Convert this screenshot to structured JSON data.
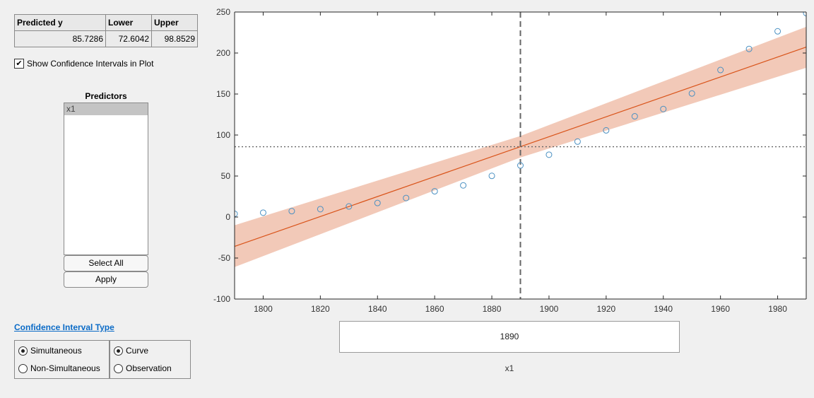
{
  "prediction_table": {
    "headers": [
      "Predicted y",
      "Lower",
      "Upper"
    ],
    "values": [
      "85.7286",
      "72.6042",
      "98.8529"
    ]
  },
  "show_ci_checkbox": {
    "label": "Show Confidence Intervals in Plot",
    "checked": true
  },
  "predictors": {
    "title": "Predictors",
    "items": [
      "x1"
    ],
    "select_all_label": "Select All",
    "apply_label": "Apply"
  },
  "ci_type": {
    "title": "Confidence Interval Type",
    "group1": [
      {
        "label": "Simultaneous",
        "selected": true
      },
      {
        "label": "Non-Simultaneous",
        "selected": false
      }
    ],
    "group2": [
      {
        "label": "Curve",
        "selected": true
      },
      {
        "label": "Observation",
        "selected": false
      }
    ]
  },
  "x_input": {
    "value": "1890",
    "label": "x1"
  },
  "colors": {
    "fit": "#d95319",
    "band": "#f2c9b8",
    "points": "#4a90c2",
    "crosshair": "#666666"
  },
  "chart_data": {
    "type": "scatter",
    "title": "",
    "xlabel": "x1",
    "ylabel": "",
    "xlim": [
      1790,
      1990
    ],
    "ylim": [
      -100,
      250
    ],
    "xticks": [
      1800,
      1820,
      1840,
      1860,
      1880,
      1900,
      1920,
      1940,
      1960,
      1980
    ],
    "yticks": [
      -100,
      -50,
      0,
      50,
      100,
      150,
      200,
      250
    ],
    "points": {
      "x": [
        1790,
        1800,
        1810,
        1820,
        1830,
        1840,
        1850,
        1860,
        1870,
        1880,
        1890,
        1900,
        1910,
        1920,
        1930,
        1940,
        1950,
        1960,
        1970,
        1980,
        1990
      ],
      "y": [
        3.9,
        5.3,
        7.2,
        9.6,
        12.9,
        17.1,
        23.2,
        31.4,
        38.6,
        50.2,
        62.9,
        76.0,
        92.0,
        105.7,
        122.8,
        131.7,
        150.7,
        179.3,
        205.0,
        226.5,
        248.7
      ]
    },
    "fit_line": {
      "x": [
        1790,
        1990
      ],
      "y": [
        -35.8,
        207.3
      ]
    },
    "ci_band": {
      "x": [
        1790,
        1890,
        1990
      ],
      "lower": [
        -61,
        72.6042,
        182
      ],
      "upper": [
        -10,
        98.8529,
        232
      ]
    },
    "crosshair": {
      "x": 1890,
      "y": 85.7286
    }
  }
}
